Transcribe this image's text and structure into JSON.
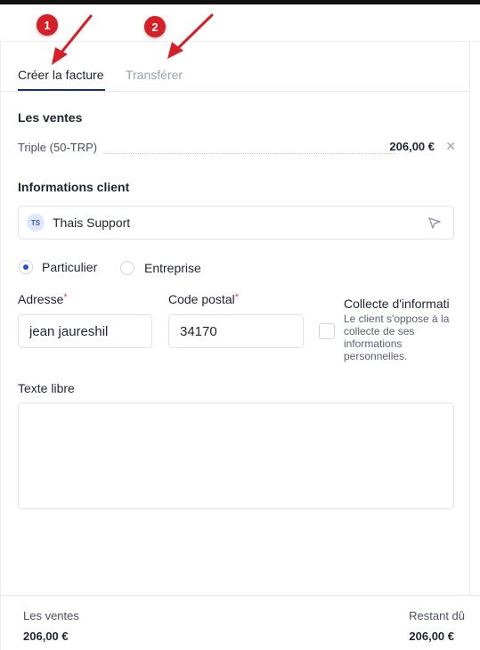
{
  "tabs": {
    "active_label": "Créer la facture",
    "inactive_label": "Transférer"
  },
  "annotations": {
    "badge_1": "1",
    "badge_2": "2",
    "color": "#d61f26"
  },
  "sales": {
    "title": "Les ventes",
    "items": [
      {
        "name": "Triple (50-TRP)",
        "price": "206,00 €",
        "remove_icon": "close-icon"
      }
    ]
  },
  "client": {
    "title": "Informations client",
    "initials": "TS",
    "name": "Thais Support",
    "action_icon": "send-icon"
  },
  "customer_type": {
    "options": [
      "Particulier",
      "Entreprise"
    ],
    "selected": "Particulier"
  },
  "address": {
    "label": "Adresse",
    "required_mark": "*",
    "value": "jean jaureshil"
  },
  "postal_code": {
    "label": "Code postal",
    "required_mark": "*",
    "value": "34170"
  },
  "consent": {
    "title": "Collecte d'informati",
    "description": "Le client s'oppose à la collecte de ses informations personnelles.",
    "checked": false
  },
  "free_text": {
    "label": "Texte libre",
    "value": ""
  },
  "footer": {
    "sales_label": "Les ventes",
    "sales_value": "206,00 €",
    "due_label": "Restant dû",
    "due_value": "206,00 €"
  },
  "colors": {
    "accent": "#1e2d6e",
    "radio": "#2a52d4",
    "required": "#e0474c"
  }
}
